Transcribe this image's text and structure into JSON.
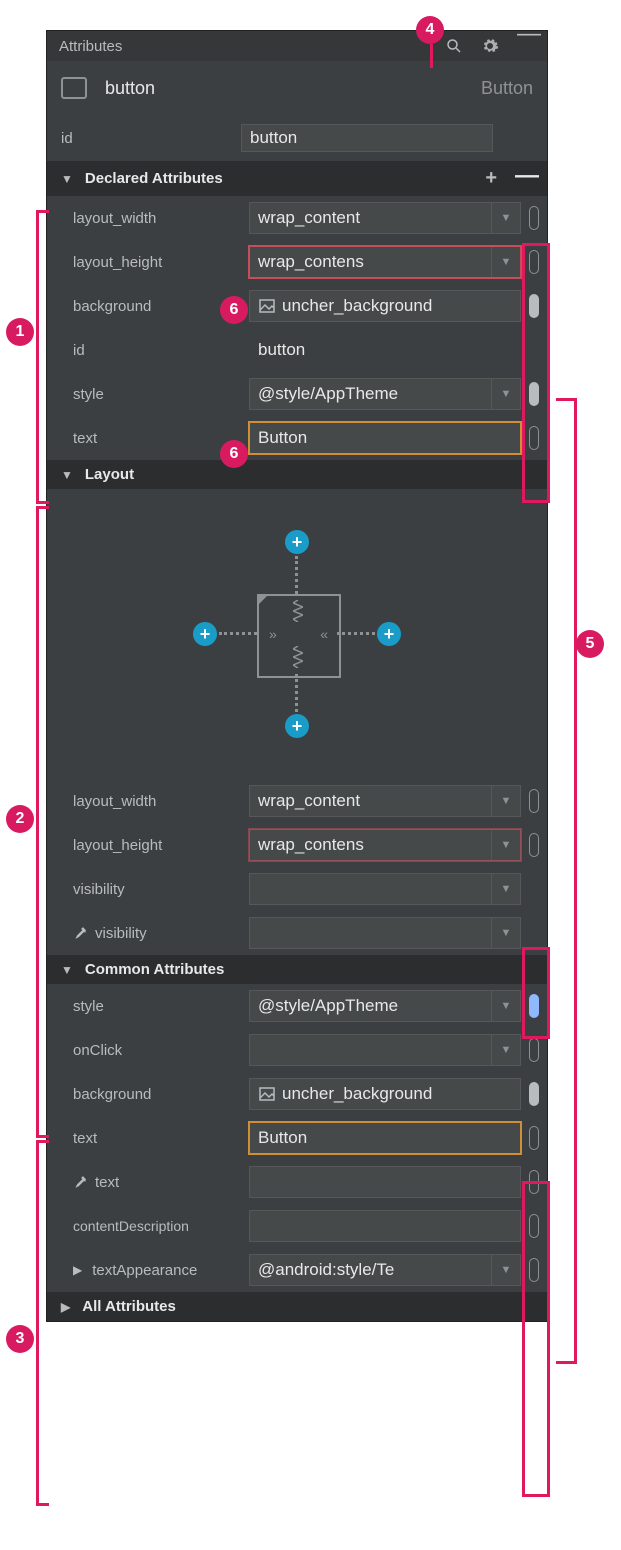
{
  "title": "Attributes",
  "component": {
    "name": "button",
    "type": "Button"
  },
  "id_row": {
    "label": "id",
    "value": "button"
  },
  "sections": {
    "declared_title": "Declared Attributes",
    "layout_title": "Layout",
    "common_title": "Common Attributes",
    "all_title": "All Attributes"
  },
  "declared": {
    "layout_width": {
      "label": "layout_width",
      "value": "wrap_content"
    },
    "layout_height": {
      "label": "layout_height",
      "value": "wrap_contens"
    },
    "background": {
      "label": "background",
      "value": "uncher_background"
    },
    "id": {
      "label": "id",
      "value": "button"
    },
    "style": {
      "label": "style",
      "value": "@style/AppTheme"
    },
    "text": {
      "label": "text",
      "value": "Button"
    }
  },
  "layout": {
    "layout_width": {
      "label": "layout_width",
      "value": "wrap_content"
    },
    "layout_height": {
      "label": "layout_height",
      "value": "wrap_contens"
    },
    "visibility": {
      "label": "visibility",
      "value": ""
    },
    "tools_visibility": {
      "label": "visibility",
      "value": ""
    }
  },
  "common": {
    "style": {
      "label": "style",
      "value": "@style/AppTheme"
    },
    "onClick": {
      "label": "onClick",
      "value": ""
    },
    "background": {
      "label": "background",
      "value": "uncher_background"
    },
    "text": {
      "label": "text",
      "value": "Button"
    },
    "tools_text": {
      "label": "text",
      "value": ""
    },
    "contentDescription": {
      "label": "contentDescription",
      "value": ""
    },
    "textAppearance": {
      "label": "textAppearance",
      "value": "@android:style/Te"
    }
  },
  "callouts": {
    "c1": "1",
    "c2": "2",
    "c3": "3",
    "c4": "4",
    "c5": "5",
    "c6": "6"
  }
}
